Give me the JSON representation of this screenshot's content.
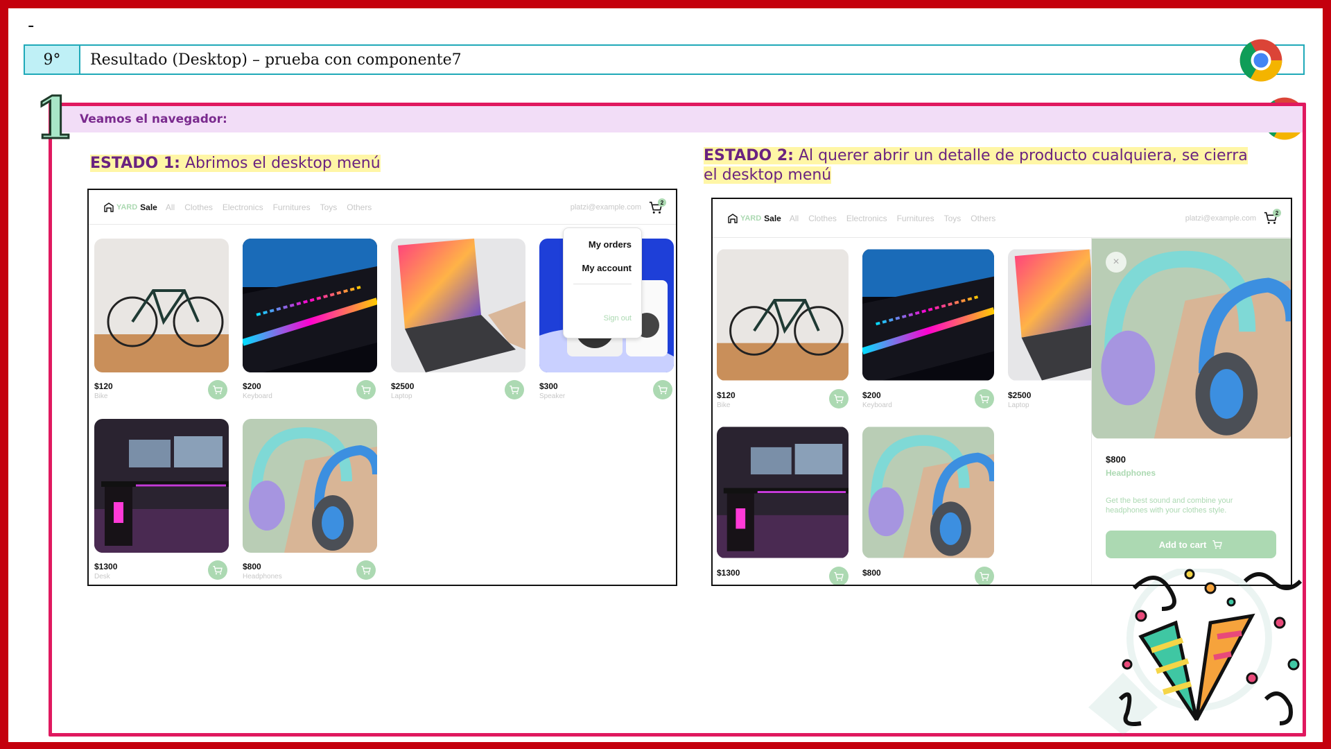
{
  "slide": {
    "dash": "-",
    "header": {
      "number": "9°",
      "title": "Resultado (Desktop) – prueba con componente7"
    },
    "step_number": "1",
    "subheading": "Veamos el navegador:",
    "colors": {
      "frame": "#c4000d",
      "accent": "#e0195f",
      "mint": "#acd9b2",
      "header_border": "#1fa9b8"
    }
  },
  "state1": {
    "label": "ESTADO 1:",
    "text": "Abrimos el desktop menú"
  },
  "state2": {
    "label": "ESTADO 2:",
    "text": "Al querer abrir un detalle de producto cualquiera, se cierra el desktop menú"
  },
  "app": {
    "logo_yard": "YARD",
    "logo_sale": "Sale",
    "nav": [
      "All",
      "Clothes",
      "Electronics",
      "Furnitures",
      "Toys",
      "Others"
    ],
    "email": "platzi@example.com",
    "cart_count": "2",
    "products": [
      {
        "price": "$120",
        "name": "Bike"
      },
      {
        "price": "$200",
        "name": "Keyboard"
      },
      {
        "price": "$2500",
        "name": "Laptop"
      },
      {
        "price": "$300",
        "name": "Speaker"
      },
      {
        "price": "$1300",
        "name": "Desk"
      },
      {
        "price": "$800",
        "name": "Headphones"
      }
    ],
    "menu": {
      "orders": "My orders",
      "account": "My account",
      "signout": "Sign out"
    },
    "detail": {
      "close": "×",
      "price": "$800",
      "name": "Headphones",
      "description": "Get the best sound and combine your headphones with your clothes style.",
      "cta": "Add to cart"
    }
  },
  "icons": [
    "chrome-icon",
    "cart-icon",
    "add-to-cart-icon",
    "close-icon",
    "confetti-icon",
    "platzi-watermark-icon"
  ]
}
